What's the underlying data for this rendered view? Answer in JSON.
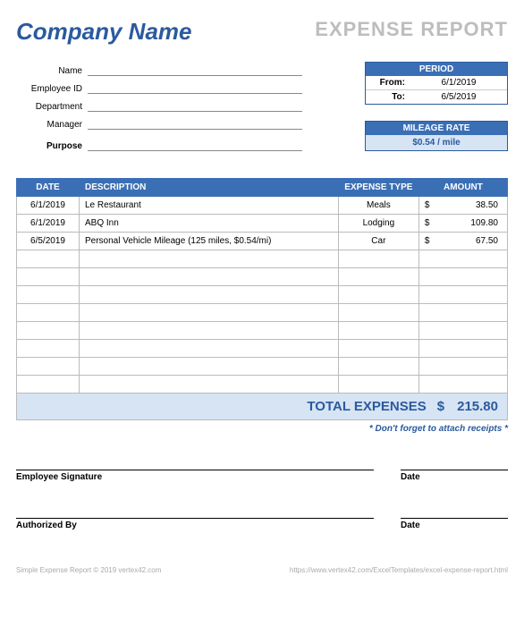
{
  "header": {
    "company_name": "Company Name",
    "title": "EXPENSE REPORT"
  },
  "info": {
    "name_label": "Name",
    "employee_id_label": "Employee ID",
    "department_label": "Department",
    "manager_label": "Manager",
    "purpose_label": "Purpose"
  },
  "period": {
    "header": "PERIOD",
    "from_label": "From:",
    "from_value": "6/1/2019",
    "to_label": "To:",
    "to_value": "6/5/2019"
  },
  "mileage": {
    "header": "MILEAGE RATE",
    "value": "$0.54 / mile"
  },
  "table": {
    "headers": {
      "date": "DATE",
      "description": "DESCRIPTION",
      "type": "EXPENSE TYPE",
      "amount": "AMOUNT"
    },
    "rows": [
      {
        "date": "6/1/2019",
        "description": "Le Restaurant",
        "type": "Meals",
        "currency": "$",
        "amount": "38.50"
      },
      {
        "date": "6/1/2019",
        "description": "ABQ Inn",
        "type": "Lodging",
        "currency": "$",
        "amount": "109.80"
      },
      {
        "date": "6/5/2019",
        "description": "Personal Vehicle Mileage (125 miles, $0.54/mi)",
        "type": "Car",
        "currency": "$",
        "amount": "67.50"
      }
    ],
    "empty_rows": 8
  },
  "total": {
    "label": "TOTAL EXPENSES",
    "currency": "$",
    "amount": "215.80"
  },
  "reminder": "* Don't forget to attach receipts *",
  "signatures": {
    "employee_label": "Employee Signature",
    "authorized_label": "Authorized By",
    "date_label": "Date"
  },
  "footer": {
    "left": "Simple Expense Report © 2019 vertex42.com",
    "right": "https://www.vertex42.com/ExcelTemplates/excel-expense-report.html"
  }
}
